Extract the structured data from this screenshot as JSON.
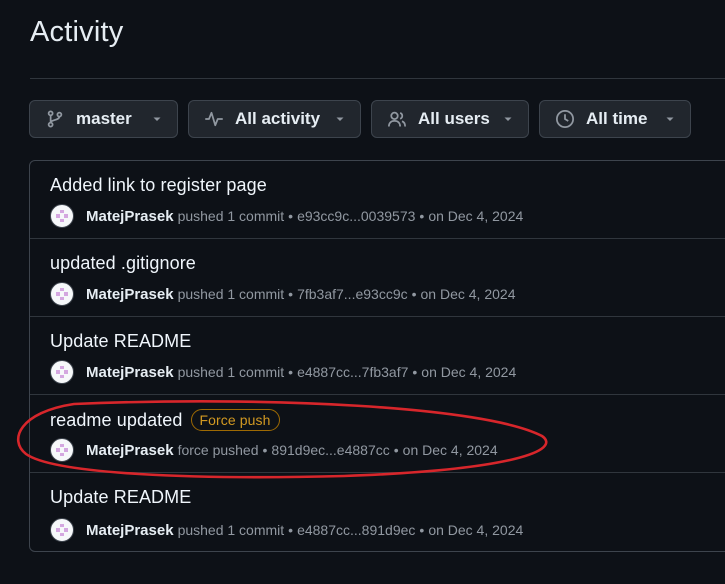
{
  "page": {
    "title": "Activity"
  },
  "filters": [
    {
      "label": "master",
      "icon": "branch-icon"
    },
    {
      "label": "All activity",
      "icon": "pulse-icon"
    },
    {
      "label": "All users",
      "icon": "people-icon"
    },
    {
      "label": "All time",
      "icon": "clock-icon"
    }
  ],
  "activity": [
    {
      "title": "Added link to register page",
      "user": "MatejPrasek",
      "action": "pushed 1 commit",
      "range": "e93cc9c...0039573",
      "date": "on Dec 4, 2024",
      "badge": ""
    },
    {
      "title": "updated .gitignore",
      "user": "MatejPrasek",
      "action": "pushed 1 commit",
      "range": "7fb3af7...e93cc9c",
      "date": "on Dec 4, 2024",
      "badge": ""
    },
    {
      "title": "Update README",
      "user": "MatejPrasek",
      "action": "pushed 1 commit",
      "range": "e4887cc...7fb3af7",
      "date": "on Dec 4, 2024",
      "badge": ""
    },
    {
      "title": "readme updated",
      "user": "MatejPrasek",
      "action": "force pushed",
      "range": "891d9ec...e4887cc",
      "date": "on Dec 4, 2024",
      "badge": "Force push"
    },
    {
      "title": "Update README",
      "user": "MatejPrasek",
      "action": "pushed 1 commit",
      "range": "e4887cc...891d9ec",
      "date": "on Dec 4, 2024",
      "badge": ""
    }
  ],
  "meta_separator": "•",
  "colors": {
    "background": "#0d1117",
    "badge": "#d29922",
    "annotation": "#d7262b"
  }
}
